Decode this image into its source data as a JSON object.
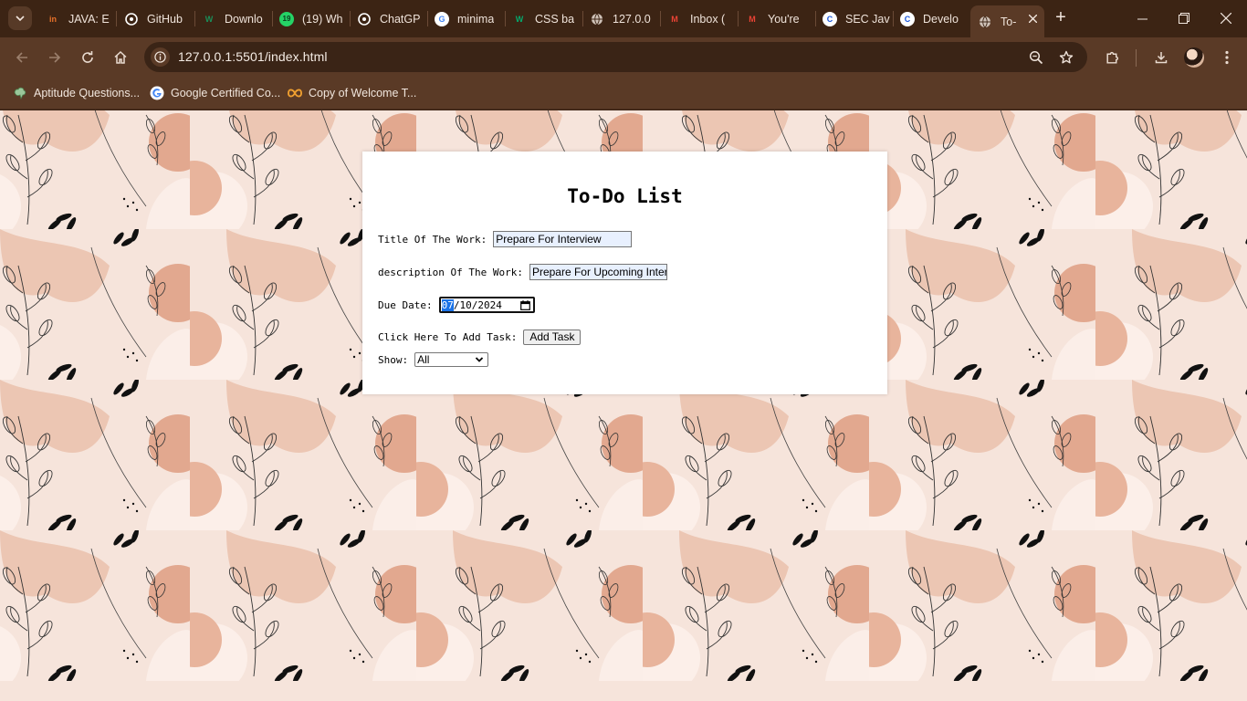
{
  "browser": {
    "tabs": [
      {
        "title": "JAVA: E",
        "favicon_icon": "in-logo-icon",
        "favicon_text": "in",
        "color": "#e8712a"
      },
      {
        "title": "GitHub",
        "favicon_icon": "github-icon",
        "favicon_text": "",
        "color": "#ffffff"
      },
      {
        "title": "Downlo",
        "favicon_icon": "w-logo-icon",
        "favicon_text": "W",
        "color": "#1a8f5a"
      },
      {
        "title": "(19) Wh",
        "favicon_icon": "whatsapp-icon",
        "favicon_text": "19",
        "color": "#25d366"
      },
      {
        "title": "ChatGP",
        "favicon_icon": "chatgpt-icon",
        "favicon_text": "",
        "color": "#ffffff"
      },
      {
        "title": "minima",
        "favicon_icon": "google-icon",
        "favicon_text": "G",
        "color": "#ffffff"
      },
      {
        "title": "CSS ba",
        "favicon_icon": "w3-logo-icon",
        "favicon_text": "W",
        "color": "#04aa6d"
      },
      {
        "title": "127.0.0",
        "favicon_icon": "globe-icon",
        "favicon_text": "",
        "color": "#cfc2b8"
      },
      {
        "title": "Inbox (",
        "favicon_icon": "gmail-icon",
        "favicon_text": "M",
        "color": "#ea4335"
      },
      {
        "title": "You're",
        "favicon_icon": "gmail-icon",
        "favicon_text": "M",
        "color": "#ea4335"
      },
      {
        "title": "SEC Jav",
        "favicon_icon": "c-logo-icon",
        "favicon_text": "C",
        "color": "#1a56db"
      },
      {
        "title": "Develo",
        "favicon_icon": "c-logo-icon",
        "favicon_text": "C",
        "color": "#1a56db"
      },
      {
        "title": "To-",
        "favicon_icon": "globe-icon",
        "favicon_text": "",
        "color": "#cfc2b8",
        "active": true
      }
    ],
    "new_tab_label": "+",
    "url": "127.0.0.1:5501/index.html",
    "bookmarks": [
      {
        "label": "Aptitude Questions...",
        "icon": "brain-icon"
      },
      {
        "label": "Google Certified Co...",
        "icon": "google-icon"
      },
      {
        "label": "Copy of Welcome T...",
        "icon": "infinity-icon"
      }
    ]
  },
  "todo": {
    "heading": "To-Do List",
    "title_label": "Title Of The Work:",
    "title_value": "Prepare For Interview",
    "description_label": "description Of The Work:",
    "description_value": "Prepare For Upcoming Interview",
    "due_label": "Due Date:",
    "due_month": "07",
    "due_day": "10",
    "due_year": "2024",
    "add_label": "Click Here To Add Task:",
    "add_button": "Add Task",
    "show_label": "Show:",
    "show_selected": "All"
  },
  "colors": {
    "chrome_dark": "#3c2414",
    "chrome_toolbar": "#5a3a26",
    "page_bg": "#f6e4db",
    "accent_peach": "#e2a88f",
    "selection_blue": "#1a73e8"
  }
}
